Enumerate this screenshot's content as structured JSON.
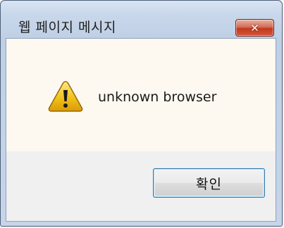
{
  "dialog": {
    "title": "웹 페이지 메시지",
    "close_symbol": "✕",
    "message": "unknown browser",
    "icon": "warning-icon",
    "ok_label": "확인"
  },
  "colors": {
    "titlebar": "#c9d7ea",
    "close_button": "#c0391e",
    "content_background": "#fdf9f0",
    "button_focus": "#3c7fb1",
    "warning_yellow": "#f2c21a"
  }
}
